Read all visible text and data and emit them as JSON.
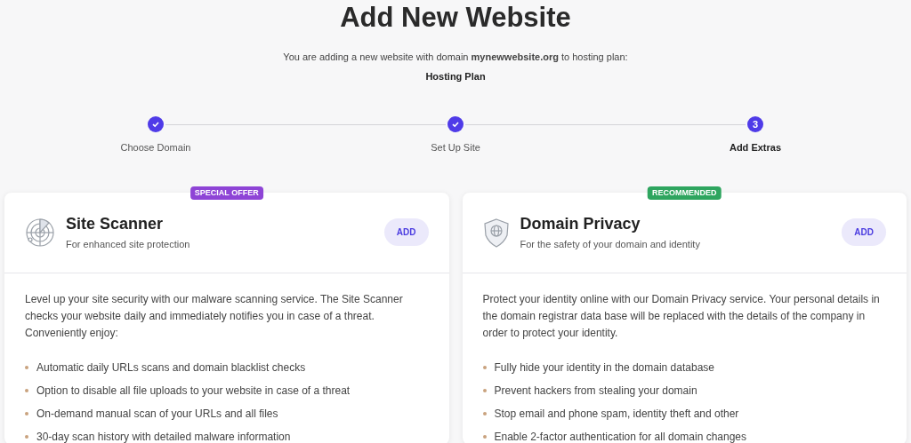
{
  "title": "Add New Website",
  "intro": "You are adding a new website with domain **mynewwebsite.org** to hosting plan:",
  "plan": "Hosting Plan",
  "steps": [
    {
      "label": "Choose Domain",
      "completed": true,
      "current": false
    },
    {
      "label": "Set Up Site",
      "completed": true,
      "current": false
    },
    {
      "label": "Add Extras",
      "number": "3",
      "completed": false,
      "current": true
    }
  ],
  "extras": [
    {
      "kind": "scanner",
      "badge": {
        "text": "SPECIAL OFFER",
        "color": "#8e44d6"
      },
      "name": "Site Scanner",
      "tagline": "For enhanced site protection",
      "button": "ADD",
      "description": "Level up your site security with our malware scanning service. The Site Scanner checks your website daily and immediately notifies you in case of a threat. Conveniently enjoy:",
      "features": [
        "Automatic daily URLs scans and domain blacklist checks",
        "Option to disable all file uploads to your website in case of a threat",
        "On-demand manual scan of your URLs and all files",
        "30-day scan history with detailed malware information"
      ]
    },
    {
      "kind": "privacy",
      "badge": {
        "text": "RECOMMENDED",
        "color": "#2ea55f"
      },
      "name": "Domain Privacy",
      "tagline": "For the safety of your domain and identity",
      "button": "ADD",
      "description": "Protect your identity online with our Domain Privacy service. Your personal details in the domain registrar data base will be replaced with the details of the company in order to protect your identity.",
      "features": [
        "Fully hide your identity in the domain database",
        "Prevent hackers from stealing your domain",
        "Stop email and phone spam, identity theft and other",
        "Enable 2-factor authentication for all domain changes"
      ]
    }
  ]
}
